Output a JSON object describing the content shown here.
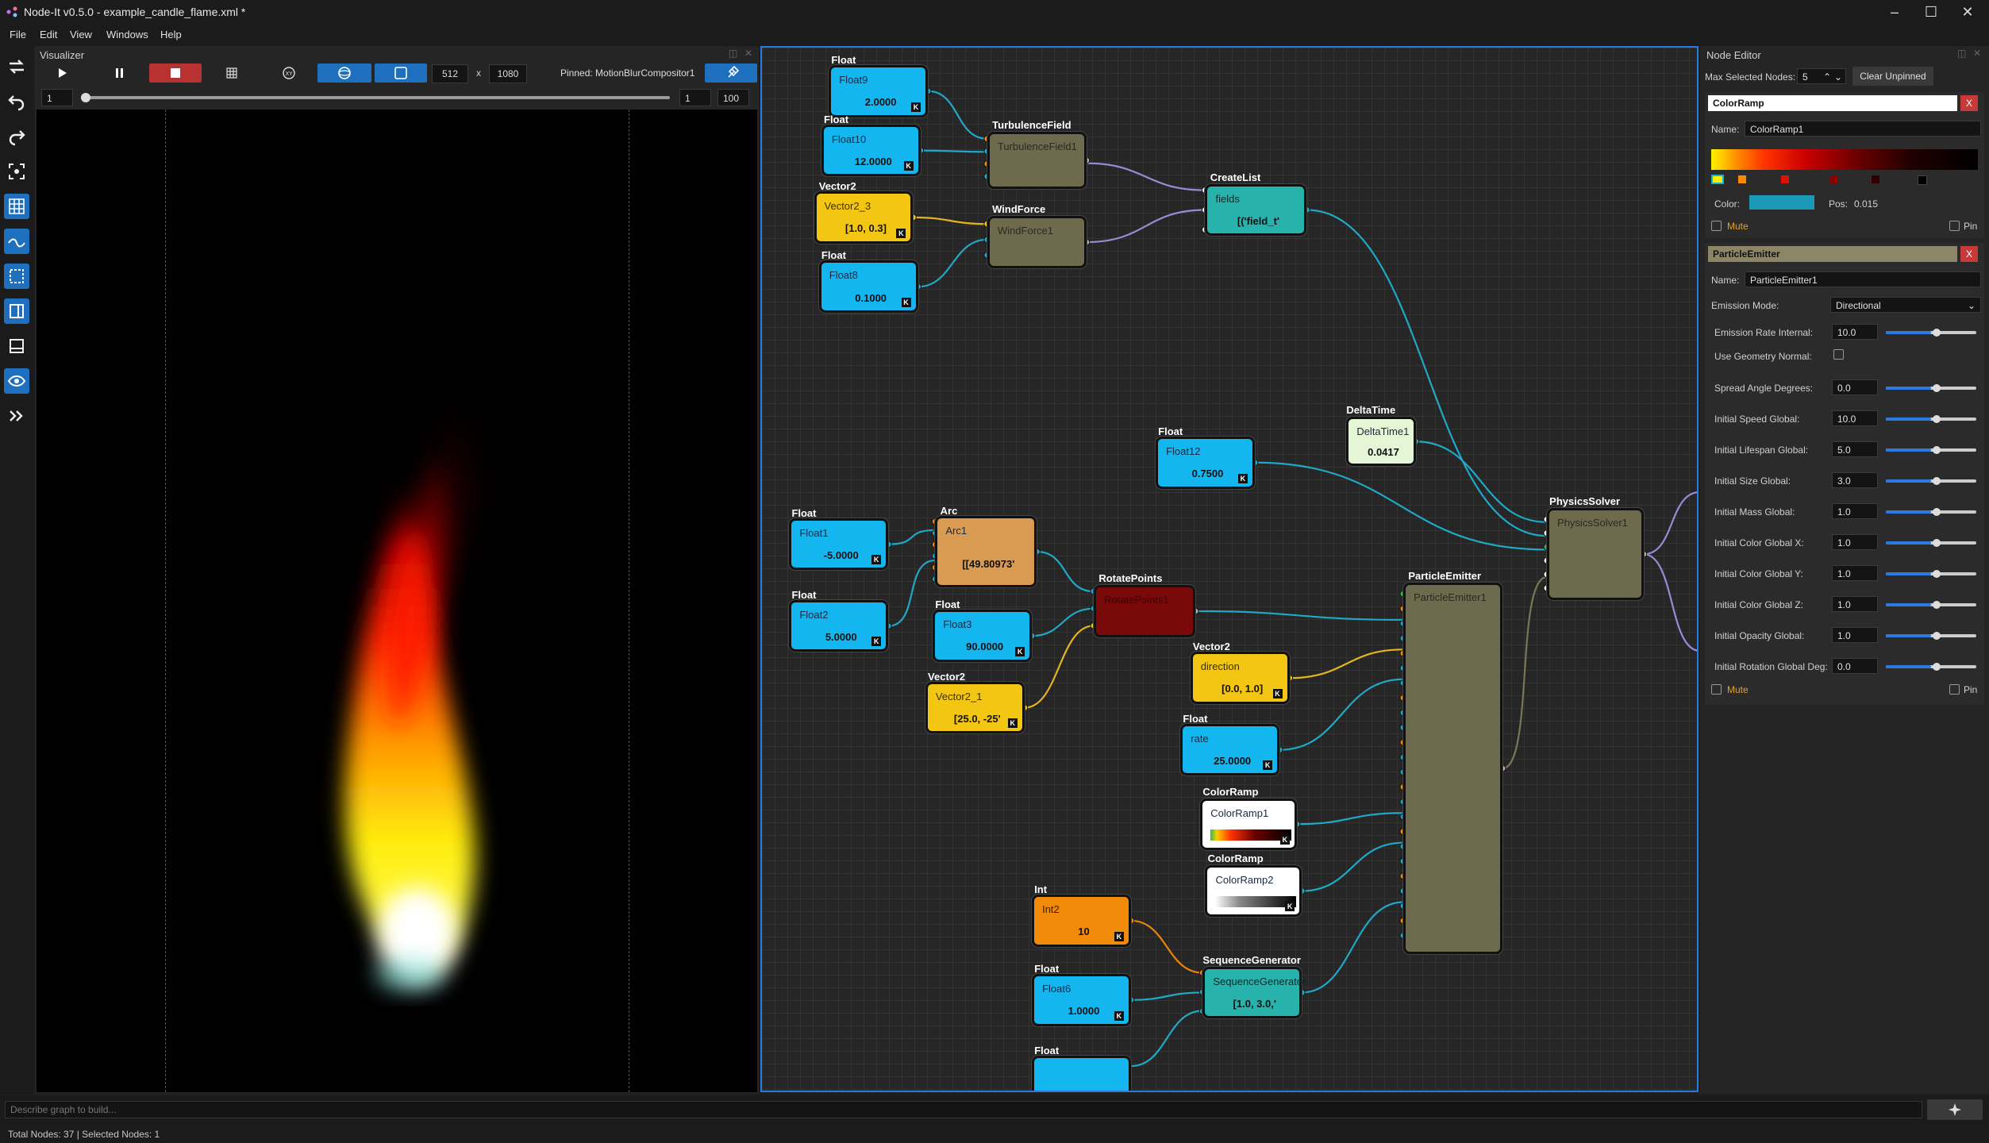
{
  "window": {
    "title": "Node-It v0.5.0 - example_candle_flame.xml *"
  },
  "menu": [
    "File",
    "Edit",
    "View",
    "Windows",
    "Help"
  ],
  "visualizer": {
    "title": "Visualizer",
    "width": "512",
    "x_sep": "x",
    "height": "1080",
    "pinned": "Pinned: MotionBlurCompositor1",
    "frame_start": "1",
    "frame_current": "1",
    "frame_end": "100",
    "progress": 0.0
  },
  "graph": {
    "nodes": [
      {
        "id": "float9",
        "header": "Float",
        "label": "Float9",
        "value": "2.0000"
      },
      {
        "id": "float10",
        "header": "Float",
        "label": "Float10",
        "value": "12.0000"
      },
      {
        "id": "vector2_3",
        "header": "Vector2",
        "label": "Vector2_3",
        "value": "[1.0, 0.3]"
      },
      {
        "id": "float8",
        "header": "Float",
        "label": "Float8",
        "value": "0.1000"
      },
      {
        "id": "turb",
        "header": "TurbulenceField",
        "label": "TurbulenceField1",
        "value": ""
      },
      {
        "id": "wind",
        "header": "WindForce",
        "label": "WindForce1",
        "value": ""
      },
      {
        "id": "createlist",
        "header": "CreateList",
        "label": "fields",
        "value": "[('field_t'"
      },
      {
        "id": "deltatime",
        "header": "DeltaTime",
        "label": "DeltaTime1",
        "value": "0.0417"
      },
      {
        "id": "float12",
        "header": "Float",
        "label": "Float12",
        "value": "0.7500"
      },
      {
        "id": "physics",
        "header": "PhysicsSolver",
        "label": "PhysicsSolver1",
        "value": ""
      },
      {
        "id": "float1",
        "header": "Float",
        "label": "Float1",
        "value": "-5.0000"
      },
      {
        "id": "float2",
        "header": "Float",
        "label": "Float2",
        "value": "5.0000"
      },
      {
        "id": "arc",
        "header": "Arc",
        "label": "Arc1",
        "value": "[[49.80973'"
      },
      {
        "id": "float3",
        "header": "Float",
        "label": "Float3",
        "value": "90.0000"
      },
      {
        "id": "vector2_1",
        "header": "Vector2",
        "label": "Vector2_1",
        "value": "[25.0, -25'"
      },
      {
        "id": "rotate",
        "header": "RotatePoints",
        "label": "RotatePoints1",
        "value": ""
      },
      {
        "id": "emitter",
        "header": "ParticleEmitter",
        "label": "ParticleEmitter1",
        "value": ""
      },
      {
        "id": "direction",
        "header": "Vector2",
        "label": "direction",
        "value": "[0.0, 1.0]"
      },
      {
        "id": "rate",
        "header": "Float",
        "label": "rate",
        "value": "25.0000"
      },
      {
        "id": "colorramp1",
        "header": "ColorRamp",
        "label": "ColorRamp1",
        "value": ""
      },
      {
        "id": "colorramp2",
        "header": "ColorRamp",
        "label": "ColorRamp2",
        "value": ""
      },
      {
        "id": "int2",
        "header": "Int",
        "label": "Int2",
        "value": "10"
      },
      {
        "id": "float6",
        "header": "Float",
        "label": "Float6",
        "value": "1.0000"
      },
      {
        "id": "seqgen",
        "header": "SequenceGenerator",
        "label": "SequenceGenerator",
        "value": "[1.0, 3.0,'"
      },
      {
        "id": "floatlast",
        "header": "Float",
        "label": "",
        "value": ""
      }
    ],
    "colors": {
      "float": "#14b6f0",
      "vector2": "#f3c614",
      "op": "#6e6a4e",
      "list": "#27b3ac",
      "arc": "#d99b52",
      "rotate": "#7a0a0a",
      "deltatime": "#e4f6d6",
      "ramp": "#ffffff",
      "int": "#f28a0a",
      "wire_blue": "#1fa9c6",
      "wire_purple": "#9b8ad8",
      "wire_yellow": "#e4b51c",
      "wire_orange": "#e8860c",
      "wire_olive": "#7a7656"
    },
    "k_label": "K"
  },
  "editor": {
    "title": "Node Editor",
    "max_selected_label": "Max Selected Nodes:",
    "max_selected_value": "5",
    "clear_unpinned": "Clear Unpinned",
    "colorramp": {
      "header": "ColorRamp",
      "name_label": "Name:",
      "name": "ColorRamp1",
      "color_label": "Color:",
      "color": "#1a9ab6",
      "pos_label": "Pos:",
      "pos": "0.015",
      "mute": "Mute",
      "pin": "Pin"
    },
    "emitter": {
      "header": "ParticleEmitter",
      "name_label": "Name:",
      "name": "ParticleEmitter1",
      "emission_mode_label": "Emission Mode:",
      "emission_mode": "Directional",
      "use_geometry_normal_label": "Use Geometry Normal:",
      "mute": "Mute",
      "pin": "Pin",
      "params": [
        {
          "label": "Emission Rate Internal:",
          "value": "10.0",
          "frac": 0.5
        },
        {
          "label": "Spread Angle Degrees:",
          "value": "0.0",
          "frac": 0.5
        },
        {
          "label": "Initial Speed Global:",
          "value": "10.0",
          "frac": 0.5
        },
        {
          "label": "Initial Lifespan Global:",
          "value": "5.0",
          "frac": 0.5
        },
        {
          "label": "Initial Size Global:",
          "value": "3.0",
          "frac": 0.5
        },
        {
          "label": "Initial Mass Global:",
          "value": "1.0",
          "frac": 0.5
        },
        {
          "label": "Initial Color Global X:",
          "value": "1.0",
          "frac": 0.5
        },
        {
          "label": "Initial Color Global Y:",
          "value": "1.0",
          "frac": 0.5
        },
        {
          "label": "Initial Color Global Z:",
          "value": "1.0",
          "frac": 0.5
        },
        {
          "label": "Initial Opacity Global:",
          "value": "1.0",
          "frac": 0.5
        },
        {
          "label": "Initial Rotation Global Deg:",
          "value": "0.0",
          "frac": 0.5
        }
      ]
    }
  },
  "command": {
    "placeholder": "Describe graph to build..."
  },
  "status": "Total Nodes: 37 | Selected Nodes: 1"
}
